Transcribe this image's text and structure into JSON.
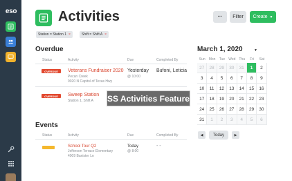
{
  "sidebar": {
    "logo": "eso",
    "items": [
      {
        "name": "activities",
        "icon": "checklist-icon",
        "color": "#2ebd5f"
      },
      {
        "name": "people",
        "icon": "people-icon",
        "color": "#3a7fd6"
      },
      {
        "name": "messages",
        "icon": "chat-icon",
        "color": "#f0b12b"
      }
    ],
    "bottom_icons": [
      "wrench-icon",
      "apps-grid-icon",
      "avatar"
    ]
  },
  "header": {
    "title": "Activities",
    "more_label": "···",
    "filter_label": "Filter",
    "create_label": "Create"
  },
  "filters": [
    {
      "label": "Station = Station 1",
      "remove": "×"
    },
    {
      "label": "Shift = Shift A",
      "remove": "×"
    }
  ],
  "columns": {
    "status": "Status",
    "activity": "Activity",
    "due": "Due",
    "completed_by": "Completed By"
  },
  "overdue": {
    "title": "Overdue",
    "rows": [
      {
        "status": "OVERDUE",
        "name": "Veterans Fundraiser 2020",
        "sub1": "Pecan Creek",
        "sub2": "9020 N Capitol of Texas Hwy",
        "due": "Yesterday",
        "due_time": "@ 10:00",
        "completed_by": "Bufoni, Leticia"
      },
      {
        "status": "OVERDUE",
        "name": "Sweep Station",
        "sub1": "Station 1, Shift A",
        "due": "",
        "due_time": "",
        "completed_by": ""
      }
    ]
  },
  "events": {
    "title": "Events",
    "rows": [
      {
        "status": "",
        "name": "School Tour Q2",
        "sub1": "Jefferson Terrace Elementary",
        "sub2": "4009 Banister Ln",
        "due": "Today",
        "due_time": "@ 8:00",
        "completed_by": "- -"
      }
    ]
  },
  "overlay_text": "SS Activities Feature",
  "calendar": {
    "title": "March 1, 2020",
    "caret": "▼",
    "weekdays": [
      "Sun",
      "Mon",
      "Tue",
      "Wed",
      "Thu",
      "Fri",
      "Sat"
    ],
    "weeks": [
      [
        "27",
        "28",
        "29",
        "30",
        "31",
        "1",
        "2"
      ],
      [
        "3",
        "4",
        "5",
        "6",
        "7",
        "8",
        "9"
      ],
      [
        "10",
        "11",
        "12",
        "13",
        "14",
        "15",
        "16"
      ],
      [
        "17",
        "18",
        "19",
        "20",
        "21",
        "22",
        "23"
      ],
      [
        "24",
        "25",
        "26",
        "27",
        "28",
        "29",
        "30"
      ],
      [
        "31",
        "1",
        "2",
        "3",
        "4",
        "5",
        "6"
      ]
    ],
    "muted": [
      [
        true,
        true,
        true,
        true,
        true,
        false,
        false
      ],
      [
        false,
        false,
        false,
        false,
        false,
        false,
        false
      ],
      [
        false,
        false,
        false,
        false,
        false,
        false,
        false
      ],
      [
        false,
        false,
        false,
        false,
        false,
        false,
        false
      ],
      [
        false,
        false,
        false,
        false,
        false,
        false,
        false
      ],
      [
        false,
        true,
        true,
        true,
        true,
        true,
        true
      ]
    ],
    "selected": {
      "week": 0,
      "day": 5
    },
    "prev_label": "◀",
    "today_label": "Today",
    "next_label": "▶"
  },
  "colors": {
    "accent": "#2ebd5f",
    "overdue": "#e2492f",
    "upcoming": "#f5b82e",
    "sidebar": "#2b3a48"
  }
}
